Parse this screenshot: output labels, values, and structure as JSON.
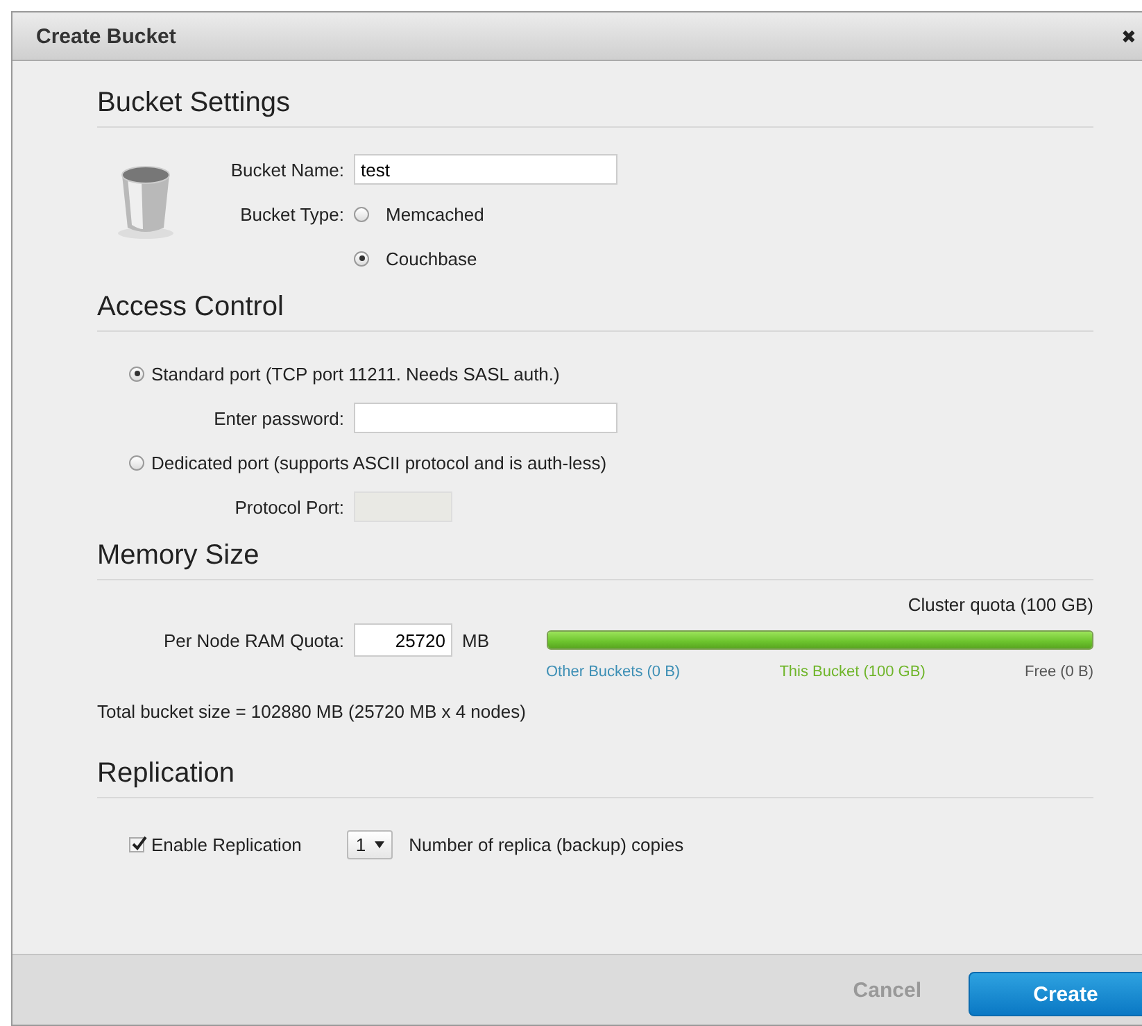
{
  "dialog": {
    "title": "Create Bucket",
    "close": "✖"
  },
  "bucket_settings": {
    "heading": "Bucket Settings",
    "name_label": "Bucket Name:",
    "name_value": "test",
    "type_label": "Bucket Type:",
    "types": [
      {
        "label": "Memcached",
        "selected": false
      },
      {
        "label": "Couchbase",
        "selected": true
      }
    ]
  },
  "access_control": {
    "heading": "Access Control",
    "options": [
      {
        "label": "Standard port (TCP port 11211. Needs SASL auth.)",
        "selected": true,
        "field_label": "Enter password:",
        "field_disabled": false
      },
      {
        "label": "Dedicated port (supports ASCII protocol and is auth-less)",
        "selected": false,
        "field_label": "Protocol Port:",
        "field_disabled": true
      }
    ]
  },
  "memory_size": {
    "heading": "Memory Size",
    "cluster_quota": "Cluster quota (100 GB)",
    "ram_label": "Per Node RAM Quota:",
    "ram_value": "25720",
    "unit": "MB",
    "level": 1,
    "legend": [
      {
        "label": "Other Buckets (0 B)",
        "color": "#3d8fb5"
      },
      {
        "label": "This Bucket (100 GB)",
        "color": "#6fb52a"
      },
      {
        "label": "Free (0 B)",
        "color": "#555555"
      }
    ],
    "total": "Total bucket size = 102880 MB (25720 MB x 4 nodes)"
  },
  "replication": {
    "heading": "Replication",
    "enabled": true,
    "label": "Enable Replication",
    "replicas": "1",
    "replicas_text": "Number of replica (backup) copies"
  },
  "buttons": [
    {
      "label": "Cancel",
      "kind": "secondary"
    },
    {
      "label": "Create",
      "kind": "primary"
    }
  ]
}
